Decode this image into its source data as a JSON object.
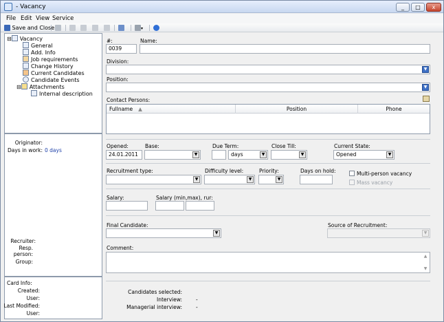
{
  "window": {
    "title": "- Vacancy",
    "btn_min": "_",
    "btn_max": "□",
    "btn_close": "x"
  },
  "menu": [
    "File",
    "Edit",
    "View",
    "Service"
  ],
  "toolbar": {
    "save_close": "Save and Close"
  },
  "tree": {
    "root": "Vacancy",
    "items": [
      "General",
      "Add. Info",
      "Job requirements",
      "Change History",
      "Current Candidates",
      "Candidate Events",
      "Attachments"
    ],
    "sub": "Internal description"
  },
  "info": {
    "originator": "Originator:",
    "days_in_work_label": "Days in work:",
    "days_in_work_value": "0 days"
  },
  "people": {
    "recruiter": "Recruiter:",
    "resp": "Resp.",
    "person": "person:",
    "group": "Group:"
  },
  "card": {
    "title": "Card Info:",
    "created": "Created:",
    "user1": "User:",
    "last_modified": "Last Modified:",
    "user2": "User:"
  },
  "form": {
    "number_label": "#:",
    "number_value": "0039",
    "name_label": "Name:",
    "name_value": "",
    "division_label": "Division:",
    "division_value": "",
    "position_label": "Position:",
    "position_value": "",
    "contacts_label": "Contact Persons:",
    "contacts_cols": [
      "Fullname",
      "Position",
      "Phone"
    ],
    "opened_label": "Opened:",
    "opened_value": "24.01.2011",
    "base_label": "Base:",
    "base_value": "",
    "due_label": "Due Term:",
    "due_num": "",
    "due_unit": "days",
    "close_till_label": "Close Till:",
    "close_till_value": "",
    "state_label": "Current State:",
    "state_value": "Opened",
    "rec_type_label": "Recruitment type:",
    "rec_type_value": "",
    "difficulty_label": "Difficulty level:",
    "difficulty_value": "",
    "priority_label": "Priority:",
    "priority_value": "",
    "days_hold_label": "Days on hold:",
    "days_hold_value": "",
    "multi_label": "Multi-person vacancy",
    "mass_label": "Mass vacancy",
    "salary_label": "Salary:",
    "salary_value": "",
    "salary_range_label": "Salary (min,max), rur:",
    "salary_min": "",
    "salary_max": "",
    "final_label": "Final Candidate:",
    "final_value": "",
    "source_label": "Source of Recruitment:",
    "source_value": "",
    "comment_label": "Comment:",
    "comment_value": "",
    "cand_selected_label": "Candidates selected:",
    "interview_label": "Interview:",
    "interview_value": "-",
    "managerial_label": "Managerial interview:",
    "managerial_value": "-"
  },
  "colors": {
    "accent": "#3d6fc5",
    "link": "#1c3fa8"
  }
}
